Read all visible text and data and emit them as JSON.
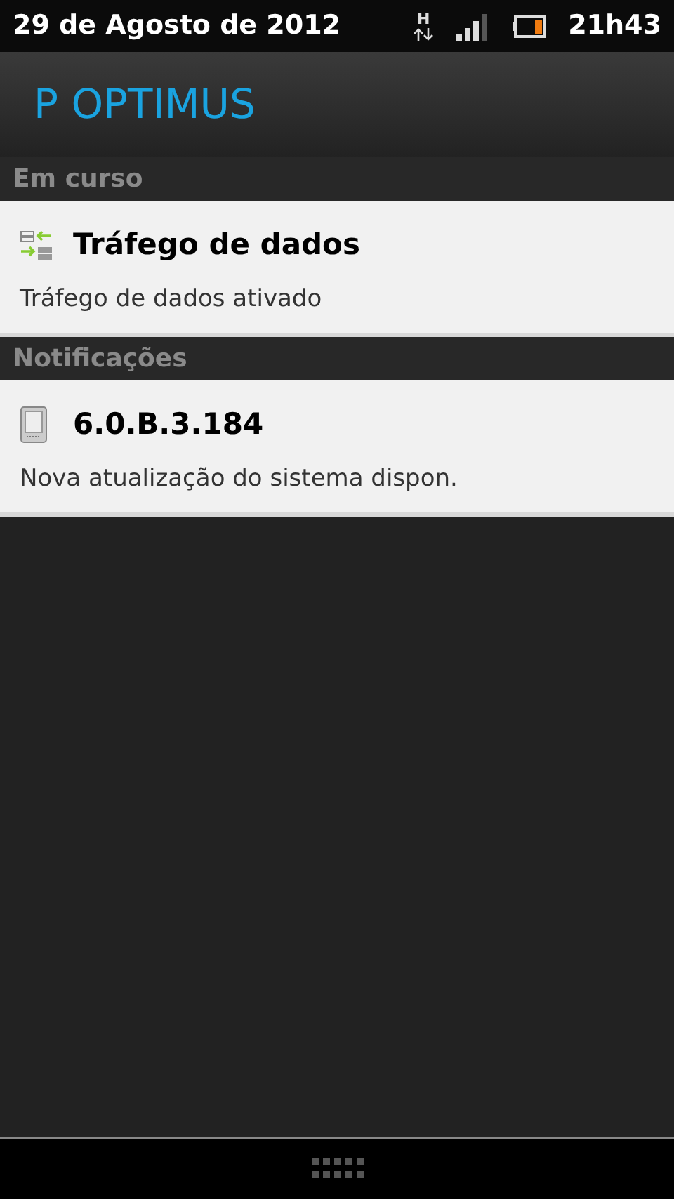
{
  "status_bar": {
    "date": "29 de Agosto de 2012",
    "network": "H",
    "time": "21h43"
  },
  "header": {
    "title": "P OPTIMUS"
  },
  "sections": [
    {
      "title": "Em curso",
      "items": [
        {
          "kind": "data-traffic",
          "title": "Tráfego de dados",
          "text": "Tráfego de dados ativado"
        }
      ]
    },
    {
      "title": "Notificações",
      "items": [
        {
          "kind": "device",
          "title": "6.0.B.3.184",
          "text": "Nova atualização do sistema dispon."
        }
      ]
    }
  ]
}
